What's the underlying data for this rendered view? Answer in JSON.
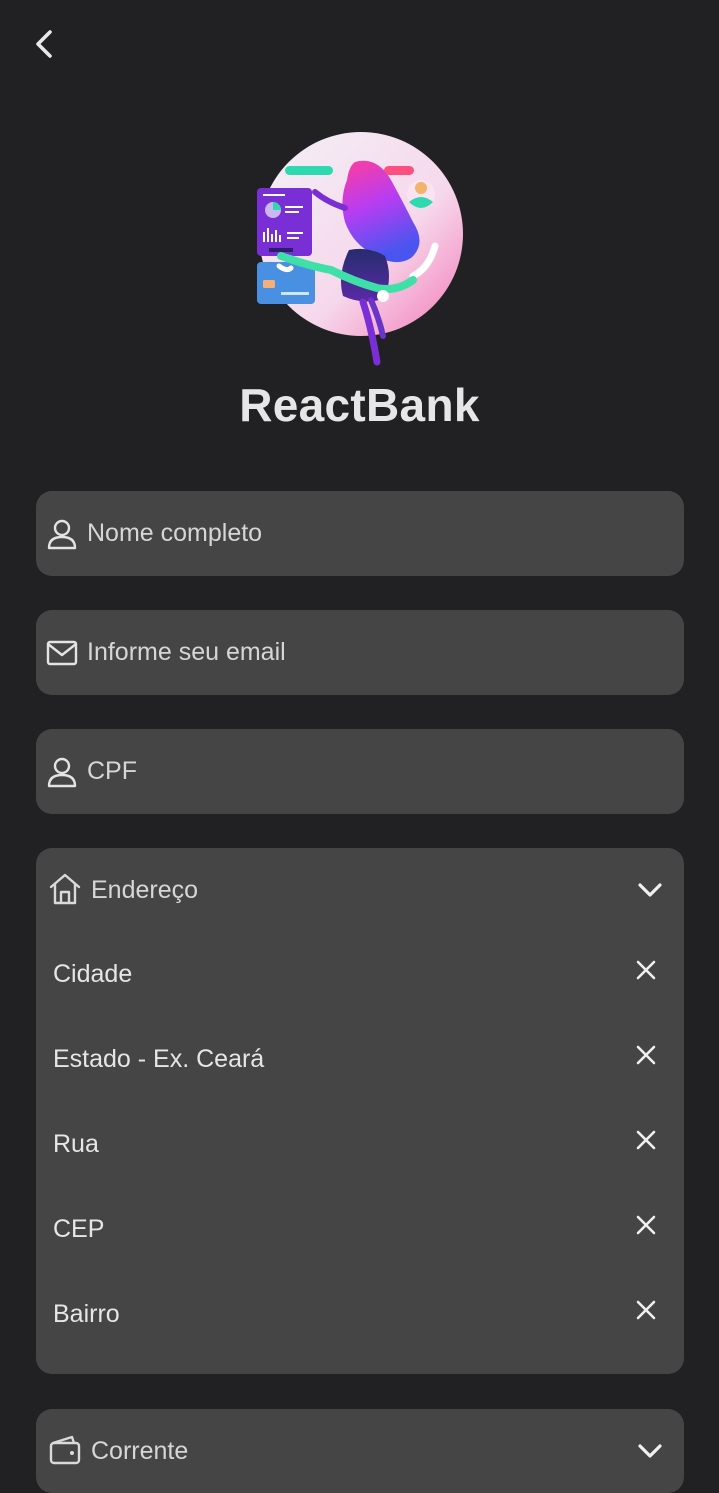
{
  "header": {
    "back_icon": "chevron-left-icon"
  },
  "brand": {
    "name": "ReactBank",
    "logo_icon": "woman-finance-illustration"
  },
  "form": {
    "full_name": {
      "placeholder": "Nome completo",
      "value": "",
      "icon": "user-icon"
    },
    "email": {
      "placeholder": "Informe seu email",
      "value": "",
      "icon": "envelope-icon"
    },
    "cpf": {
      "placeholder": "CPF",
      "value": "",
      "icon": "user-icon"
    },
    "address": {
      "label": "Endereço",
      "icon": "home-icon",
      "toggle_icon": "chevron-down-icon",
      "fields": [
        {
          "label": "Cidade",
          "clear_icon": "close-icon"
        },
        {
          "label": "Estado - Ex. Ceará",
          "clear_icon": "close-icon"
        },
        {
          "label": "Rua",
          "clear_icon": "close-icon"
        },
        {
          "label": "CEP",
          "clear_icon": "close-icon"
        },
        {
          "label": "Bairro",
          "clear_icon": "close-icon"
        }
      ]
    },
    "account": {
      "label": "Corrente",
      "icon": "wallet-icon",
      "toggle_icon": "chevron-down-icon"
    }
  },
  "colors": {
    "background": "#212123",
    "field_bg": "#454546",
    "text": "#e6e6e6",
    "placeholder": "#d6d6d6"
  }
}
